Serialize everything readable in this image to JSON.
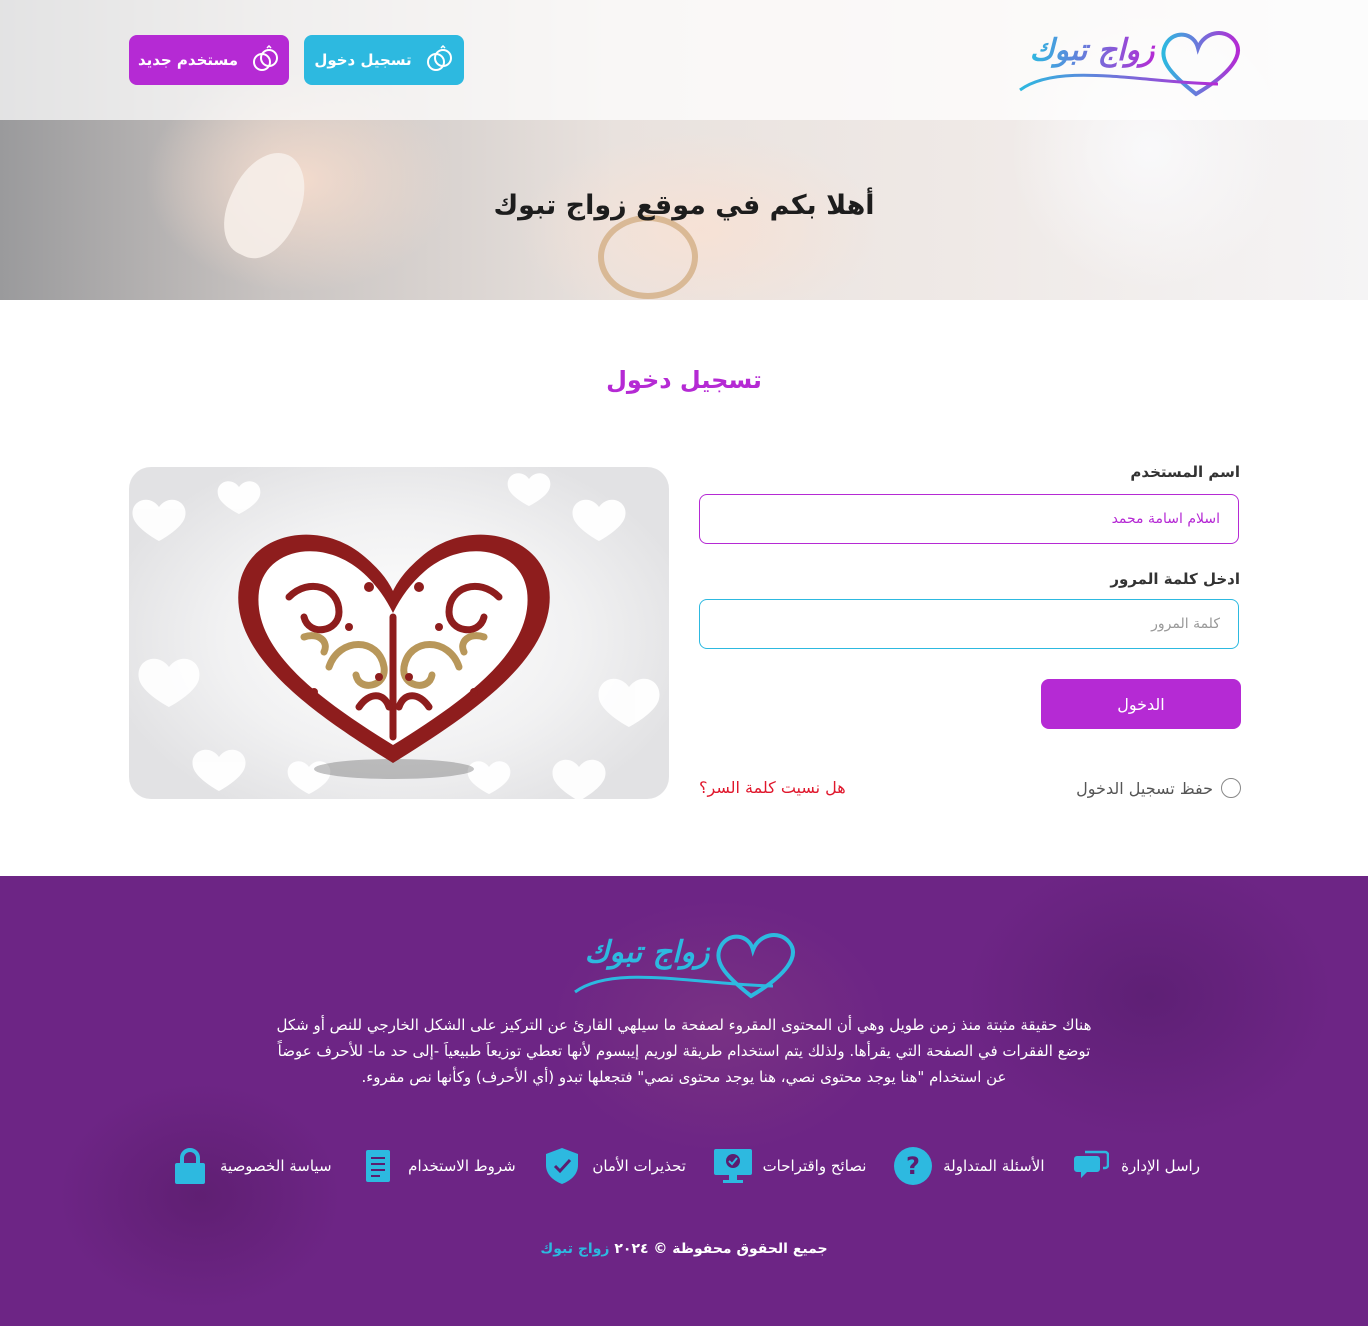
{
  "header": {
    "logo_text": "زواج تبوك",
    "login_button": "تسجيل دخول",
    "new_user_button": "مستخدم جديد",
    "welcome_title": "أهلا بكم في موقع زواج تبوك"
  },
  "login": {
    "title": "تسجيل دخول",
    "username_label": "اسم المستخدم",
    "username_value": "اسلام اسامة محمد",
    "password_label": "ادخل كلمة المرور",
    "password_placeholder": "كلمة المرور",
    "submit_label": "الدخول",
    "remember_label": "حفظ تسجيل الدخول",
    "forgot_label": "هل نسيت كلمة السر؟"
  },
  "footer": {
    "logo_text": "زواج تبوك",
    "description": "هناك حقيقة مثبتة منذ زمن طويل وهي أن المحتوى المقروء لصفحة ما سيلهي القارئ عن التركيز على الشكل الخارجي للنص أو شكل توضع الفقرات في الصفحة التي يقرأها. ولذلك يتم استخدام طريقة لوريم إيبسوم لأنها تعطي توزيعاَ طبيعياَ -إلى حد ما- للأحرف عوضاً عن استخدام \"هنا يوجد محتوى نصي، هنا يوجد محتوى نصي\" فتجعلها تبدو (أي الأحرف) وكأنها نص مقروء.",
    "links": [
      {
        "label": "راسل الإدارة",
        "icon": "chat-icon"
      },
      {
        "label": "الأسئلة المتداولة",
        "icon": "question-icon"
      },
      {
        "label": "نصائح واقتراحات",
        "icon": "monitor-check-icon"
      },
      {
        "label": "تحذيرات الأمان",
        "icon": "shield-check-icon"
      },
      {
        "label": "شروط الاستخدام",
        "icon": "document-icon"
      },
      {
        "label": "سياسة الخصوصية",
        "icon": "lock-icon"
      }
    ],
    "copyright_prefix": "جميع الحقوق محفوظة © ٢٠٢٤",
    "copyright_brand": "زواج تبوك"
  },
  "colors": {
    "primary_purple": "#b52ad4",
    "primary_cyan": "#2db9e0",
    "footer_bg": "#6d2585",
    "forgot_red": "#e0182d"
  }
}
